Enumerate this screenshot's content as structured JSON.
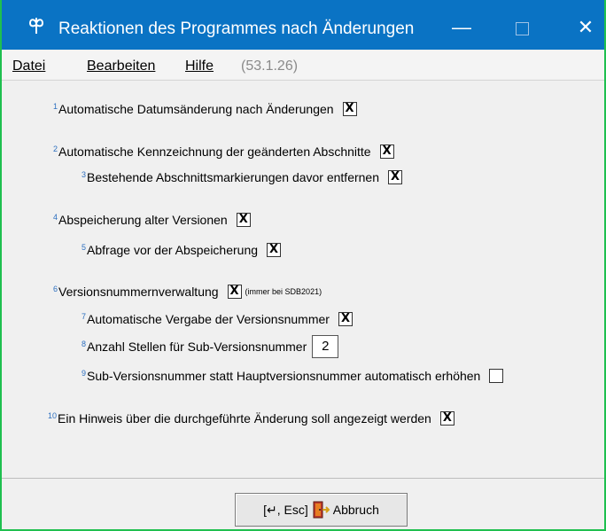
{
  "window": {
    "title": "Reaktionen des Programmes nach Änderungen",
    "controls": {
      "minimize": "—",
      "close": "✕"
    }
  },
  "menu": {
    "items": [
      "Datei",
      "Bearbeiten",
      "Hilfe"
    ],
    "version": "(53.1.26)"
  },
  "options": [
    {
      "num": "1",
      "label": "Automatische Datumsänderung nach Änderungen",
      "checked": true
    },
    {
      "num": "2",
      "label": "Automatische Kennzeichnung der geänderten Abschnitte",
      "checked": true
    },
    {
      "num": "3",
      "label": "Bestehende Abschnittsmarkierungen davor entfernen",
      "checked": true
    },
    {
      "num": "4",
      "label": "Abspeicherung alter Versionen",
      "checked": true
    },
    {
      "num": "5",
      "label": "Abfrage vor der Abspeicherung",
      "checked": true
    },
    {
      "num": "6",
      "label": "Versionsnummernverwaltung",
      "checked": true,
      "note": "(immer bei SDB2021)"
    },
    {
      "num": "7",
      "label": "Automatische Vergabe der Versionsnummer",
      "checked": true
    },
    {
      "num": "8",
      "label": " Anzahl Stellen für Sub-Versionsnummer",
      "value": "2"
    },
    {
      "num": "9",
      "label": "Sub-Versionsnummer statt Hauptversionsnummer automatisch erhöhen",
      "checked": false
    },
    {
      "num": "10",
      "label": "Ein Hinweis über die durchgeführte Änderung soll angezeigt werden",
      "checked": true
    }
  ],
  "checkmark": "X",
  "footer": {
    "cancel_keys": "[↵, Esc]",
    "cancel_label": "Abbruch"
  },
  "colors": {
    "titlebar": "#0a73c4",
    "border": "#1fbf4f",
    "number": "#2d6fbf"
  }
}
